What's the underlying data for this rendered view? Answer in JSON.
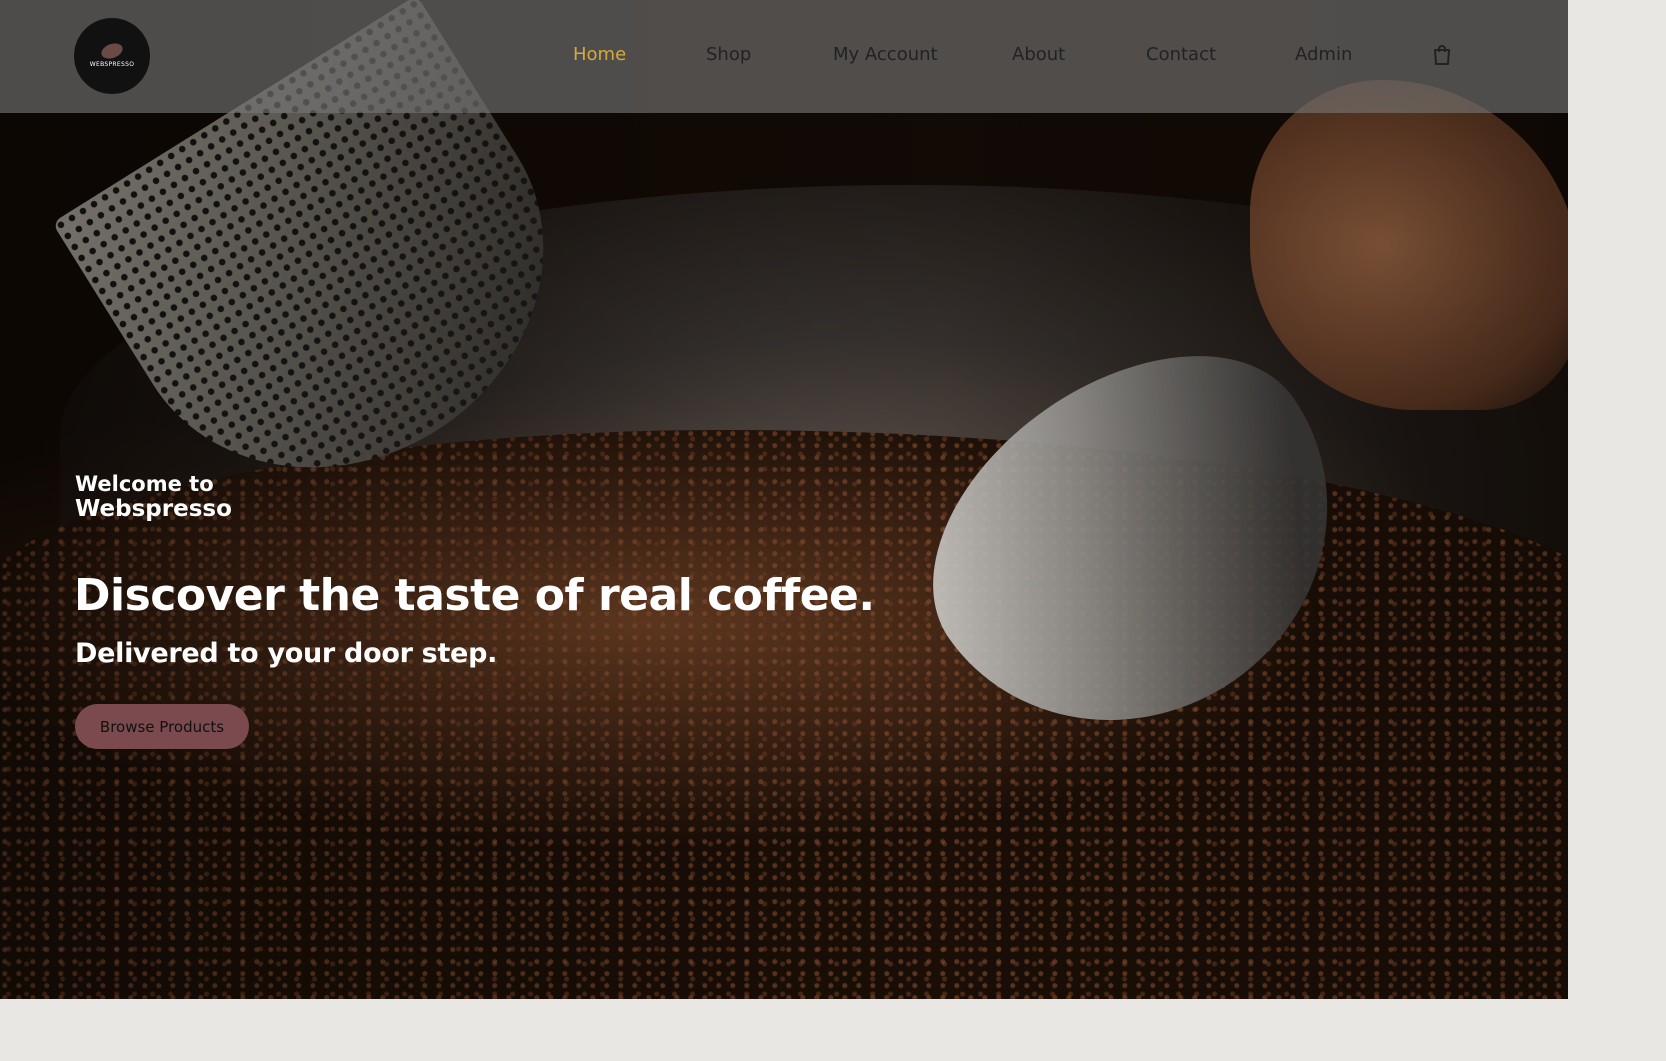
{
  "logo": {
    "text": "WEBSPRESSO"
  },
  "nav": {
    "items": [
      {
        "label": "Home",
        "active": true
      },
      {
        "label": "Shop",
        "active": false
      },
      {
        "label": "My Account",
        "active": false
      },
      {
        "label": "About",
        "active": false
      },
      {
        "label": "Contact",
        "active": false
      },
      {
        "label": "Admin",
        "active": false
      }
    ],
    "cart_icon": "shopping-bag-icon",
    "active_color": "#d8a93a"
  },
  "hero": {
    "welcome_line1": "Welcome to",
    "welcome_line2": "Webspresso",
    "headline": "Discover the taste of real coffee.",
    "subheadline": "Delivered to your door step.",
    "cta_label": "Browse Products",
    "cta_color": "#7a4a4e"
  }
}
